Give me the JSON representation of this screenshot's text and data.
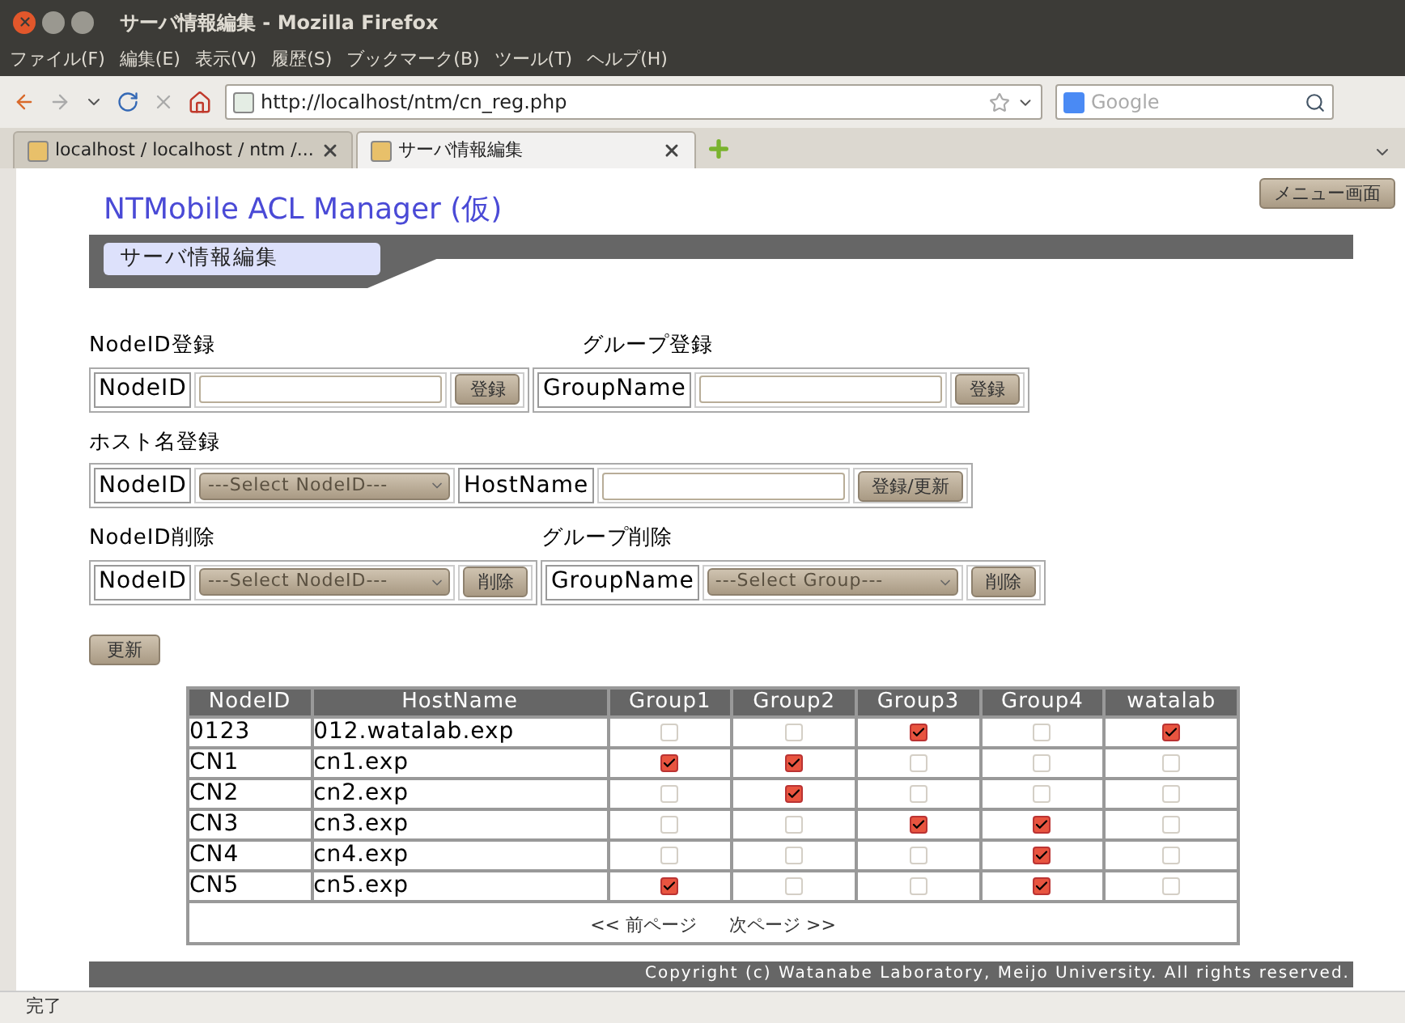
{
  "window": {
    "title": "サーバ情報編集 - Mozilla Firefox"
  },
  "menu": [
    "ファイル(F)",
    "編集(E)",
    "表示(V)",
    "履歴(S)",
    "ブックマーク(B)",
    "ツール(T)",
    "ヘルプ(H)"
  ],
  "toolbar": {
    "url": "http://localhost/ntm/cn_reg.php",
    "search_placeholder": "Google"
  },
  "tabs": [
    {
      "label": "localhost / localhost / ntm /...",
      "selected": false
    },
    {
      "label": "サーバ情報編集",
      "selected": true
    }
  ],
  "page": {
    "title": "NTMobile ACL Manager (仮)",
    "menu_button": "メニュー画面",
    "section": "サーバ情報編集",
    "form_rows": [
      {
        "groups": [
          {
            "heading": "NodeID登録",
            "cells": [
              {
                "kind": "label",
                "text": "NodeID"
              },
              {
                "kind": "input"
              },
              {
                "kind": "button",
                "text": "登録"
              }
            ]
          },
          {
            "heading": "グループ登録",
            "cells": [
              {
                "kind": "label",
                "text": "GroupName"
              },
              {
                "kind": "input"
              },
              {
                "kind": "button",
                "text": "登録"
              }
            ]
          }
        ]
      },
      {
        "groups": [
          {
            "heading": "ホスト名登録",
            "cells": [
              {
                "kind": "label",
                "text": "NodeID"
              },
              {
                "kind": "select",
                "text": "---Select NodeID---"
              },
              {
                "kind": "label",
                "text": "HostName"
              },
              {
                "kind": "input"
              },
              {
                "kind": "button",
                "text": "登録/更新"
              }
            ]
          }
        ]
      },
      {
        "groups": [
          {
            "heading": "NodeID削除",
            "cells": [
              {
                "kind": "label",
                "text": "NodeID"
              },
              {
                "kind": "select",
                "text": "---Select NodeID---"
              },
              {
                "kind": "button",
                "text": "削除"
              }
            ]
          },
          {
            "heading": "グループ削除",
            "cells": [
              {
                "kind": "label",
                "text": "GroupName"
              },
              {
                "kind": "select",
                "text": "---Select Group---"
              },
              {
                "kind": "button",
                "text": "削除"
              }
            ]
          }
        ]
      }
    ],
    "update_button": "更新",
    "table": {
      "columns": [
        "NodeID",
        "HostName",
        "Group1",
        "Group2",
        "Group3",
        "Group4",
        "watalab"
      ],
      "rows": [
        {
          "node_id": "0123",
          "host_name": "012.watalab.exp",
          "groups": [
            false,
            false,
            true,
            false,
            true
          ]
        },
        {
          "node_id": "CN1",
          "host_name": "cn1.exp",
          "groups": [
            true,
            true,
            false,
            false,
            false
          ]
        },
        {
          "node_id": "CN2",
          "host_name": "cn2.exp",
          "groups": [
            false,
            true,
            false,
            false,
            false
          ]
        },
        {
          "node_id": "CN3",
          "host_name": "cn3.exp",
          "groups": [
            false,
            false,
            true,
            true,
            false
          ]
        },
        {
          "node_id": "CN4",
          "host_name": "cn4.exp",
          "groups": [
            false,
            false,
            false,
            true,
            false
          ]
        },
        {
          "node_id": "CN5",
          "host_name": "cn5.exp",
          "groups": [
            true,
            false,
            false,
            true,
            false
          ]
        }
      ],
      "pager": {
        "prev": "<< 前ページ",
        "next": "次ページ >>"
      }
    },
    "footer": "Copyright (c) Watanabe Laboratory, Meijo University. All rights reserved."
  },
  "status_bar": "完了"
}
